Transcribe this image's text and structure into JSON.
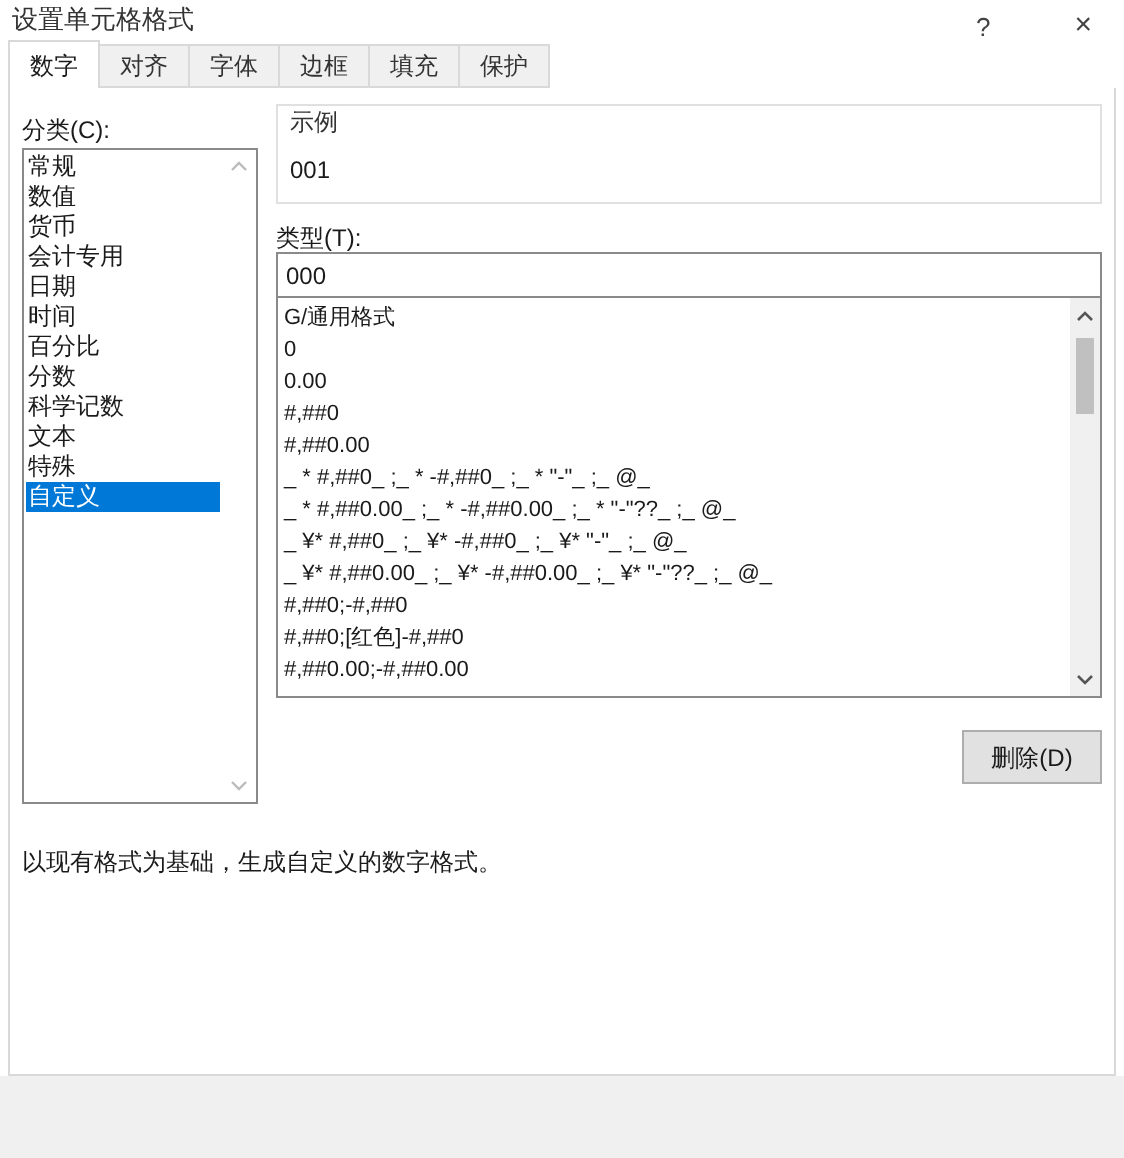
{
  "window": {
    "title": "设置单元格格式",
    "help": "?",
    "close": "×"
  },
  "tabs": [
    {
      "label": "数字",
      "selected": true
    },
    {
      "label": "对齐",
      "selected": false
    },
    {
      "label": "字体",
      "selected": false
    },
    {
      "label": "边框",
      "selected": false
    },
    {
      "label": "填充",
      "selected": false
    },
    {
      "label": "保护",
      "selected": false
    }
  ],
  "category": {
    "label": "分类(C):",
    "items": [
      {
        "label": "常规",
        "selected": false
      },
      {
        "label": "数值",
        "selected": false
      },
      {
        "label": "货币",
        "selected": false
      },
      {
        "label": "会计专用",
        "selected": false
      },
      {
        "label": "日期",
        "selected": false
      },
      {
        "label": "时间",
        "selected": false
      },
      {
        "label": "百分比",
        "selected": false
      },
      {
        "label": "分数",
        "selected": false
      },
      {
        "label": "科学记数",
        "selected": false
      },
      {
        "label": "文本",
        "selected": false
      },
      {
        "label": "特殊",
        "selected": false
      },
      {
        "label": "自定义",
        "selected": true
      }
    ]
  },
  "sample": {
    "label": "示例",
    "value": "001"
  },
  "type": {
    "label": "类型(T):",
    "value": "000",
    "items": [
      "G/通用格式",
      "0",
      "0.00",
      "#,##0",
      "#,##0.00",
      "_ * #,##0_ ;_ * -#,##0_ ;_ * \"-\"_ ;_ @_",
      "_ * #,##0.00_ ;_ * -#,##0.00_ ;_ * \"-\"??_ ;_ @_",
      "_ ¥* #,##0_ ;_ ¥* -#,##0_ ;_ ¥* \"-\"_ ;_ @_",
      "_ ¥* #,##0.00_ ;_ ¥* -#,##0.00_ ;_ ¥* \"-\"??_ ;_ @_",
      "#,##0;-#,##0",
      "#,##0;[红色]-#,##0",
      "#,##0.00;-#,##0.00"
    ]
  },
  "delete_button": "删除(D)",
  "description": "以现有格式为基础，生成自定义的数字格式。"
}
